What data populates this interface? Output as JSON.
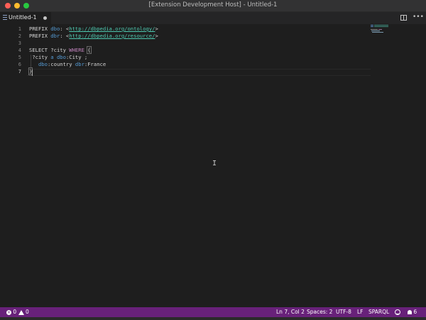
{
  "window": {
    "title": "[Extension Development Host] - Untitled-1"
  },
  "tabs": [
    {
      "label": "Untitled-1",
      "dirty": true,
      "icon": "list-icon"
    }
  ],
  "editor": {
    "line_numbers": [
      "1",
      "2",
      "3",
      "4",
      "5",
      "6",
      "7"
    ],
    "current_line": 7,
    "lines": [
      [
        {
          "t": "PREFIX ",
          "c": "kw"
        },
        {
          "t": "dbo",
          "c": "prefix"
        },
        {
          "t": ": <",
          "c": "kw"
        },
        {
          "t": "http://dbpedia.org/ontology/",
          "c": "iri"
        },
        {
          "t": ">",
          "c": "kw"
        }
      ],
      [
        {
          "t": "PREFIX ",
          "c": "kw"
        },
        {
          "t": "dbr",
          "c": "prefix"
        },
        {
          "t": ": <",
          "c": "kw"
        },
        {
          "t": "http://dbpedia.org/resource/",
          "c": "iri"
        },
        {
          "t": ">",
          "c": "kw"
        }
      ],
      [],
      [
        {
          "t": "SELECT ",
          "c": "kw"
        },
        {
          "t": "?city ",
          "c": "var"
        },
        {
          "t": "WHERE",
          "c": "where"
        },
        {
          "t": " ",
          "c": "kw"
        },
        {
          "t": "{",
          "c": "brace"
        }
      ],
      [
        {
          "t": " ?city ",
          "c": "var"
        },
        {
          "t": "a ",
          "c": "a"
        },
        {
          "t": "dbo",
          "c": "prefix"
        },
        {
          "t": ":City ;",
          "c": "kw"
        }
      ],
      [
        {
          "t": "   ",
          "c": "kw"
        },
        {
          "t": "dbo",
          "c": "prefix"
        },
        {
          "t": ":country ",
          "c": "kw"
        },
        {
          "t": "dbr",
          "c": "prefix"
        },
        {
          "t": ":France",
          "c": "kw"
        }
      ],
      [
        {
          "t": "}",
          "c": "brace"
        }
      ]
    ]
  },
  "status_bar": {
    "errors": "0",
    "warnings": "0",
    "position": "Ln 7, Col 2",
    "spaces": "Spaces: 2",
    "encoding": "UTF-8",
    "eol": "LF",
    "language": "SPARQL",
    "notifications": "6"
  },
  "colors": {
    "status_bar": "#68217a",
    "editor_bg": "#1e1e1e",
    "tab_bar_bg": "#252526"
  }
}
